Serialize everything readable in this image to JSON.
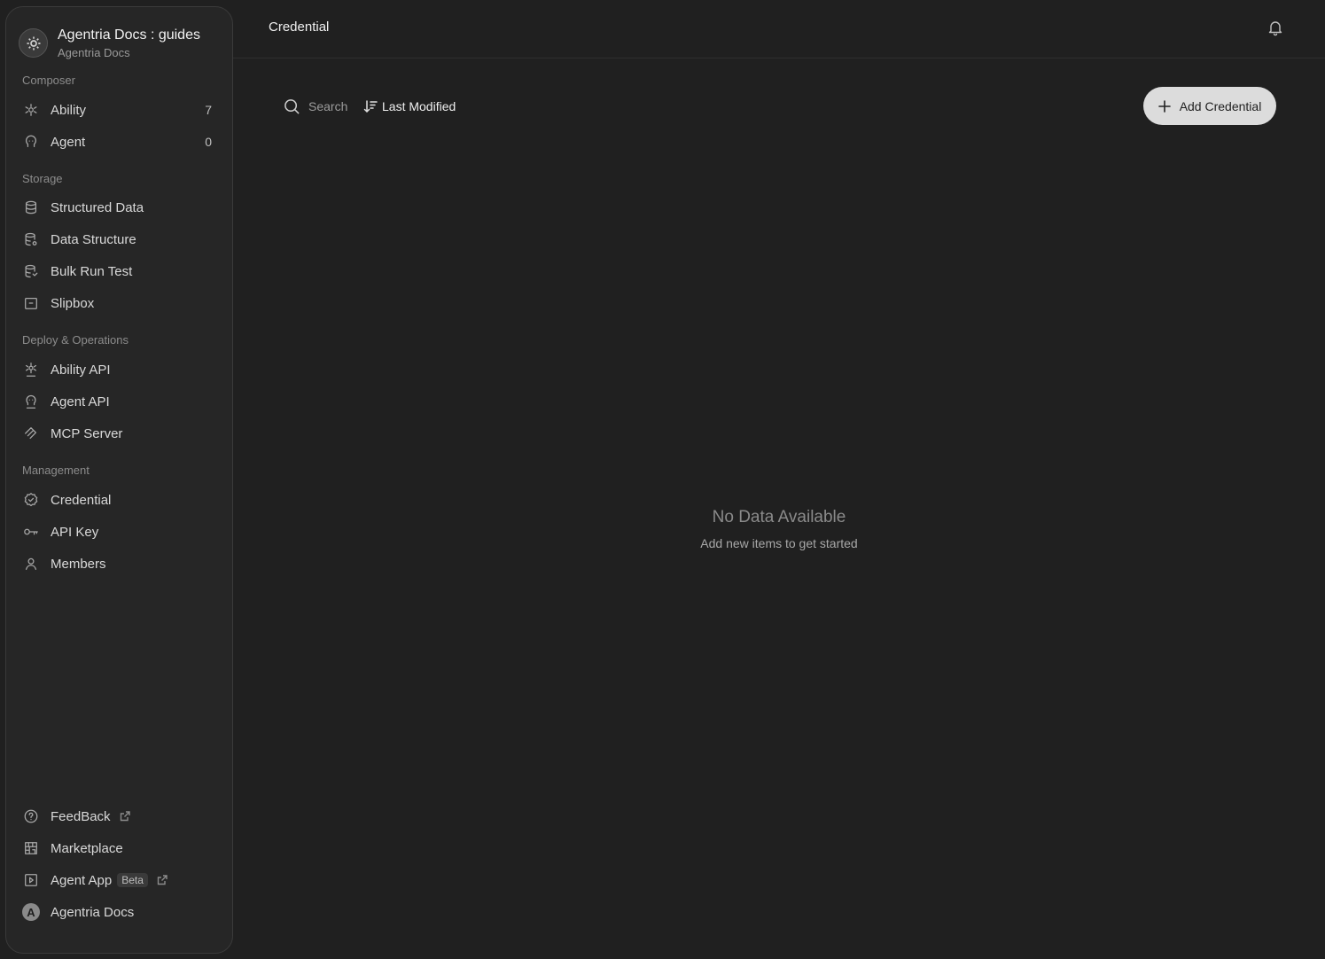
{
  "workspace": {
    "title": "Agentria Docs : guides",
    "subtitle": "Agentria Docs",
    "logo_icon": "gear-icon"
  },
  "sidebar": {
    "sections": [
      {
        "label": "Composer"
      },
      {
        "label": "Storage"
      },
      {
        "label": "Deploy & Operations"
      },
      {
        "label": "Management"
      }
    ],
    "composer": [
      {
        "label": "Ability",
        "count": "7",
        "icon": "ability-icon"
      },
      {
        "label": "Agent",
        "count": "0",
        "icon": "agent-icon"
      }
    ],
    "storage": [
      {
        "label": "Structured Data",
        "icon": "database-icon"
      },
      {
        "label": "Data Structure",
        "icon": "database-settings-icon"
      },
      {
        "label": "Bulk Run Test",
        "icon": "database-test-icon"
      },
      {
        "label": "Slipbox",
        "icon": "box-icon"
      }
    ],
    "deploy": [
      {
        "label": "Ability API",
        "icon": "ability-api-icon"
      },
      {
        "label": "Agent API",
        "icon": "agent-api-icon"
      },
      {
        "label": "MCP Server",
        "icon": "mcp-icon"
      }
    ],
    "management": [
      {
        "label": "Credential",
        "icon": "badge-check-icon"
      },
      {
        "label": "API Key",
        "icon": "key-icon"
      },
      {
        "label": "Members",
        "icon": "user-icon"
      }
    ],
    "footer": [
      {
        "label": "FeedBack",
        "icon": "help-circle-icon"
      },
      {
        "label": "Marketplace",
        "icon": "store-icon"
      },
      {
        "label": "Agent App",
        "badge": "Beta",
        "icon": "play-square-icon"
      },
      {
        "label": "Agentria Docs",
        "avatar_letter": "A"
      }
    ]
  },
  "header": {
    "title": "Credential",
    "bell_icon": "bell-icon"
  },
  "toolbar": {
    "search_placeholder": "Search",
    "sort_label": "Last Modified",
    "add_label": "Add Credential"
  },
  "empty_state": {
    "title": "No Data Available",
    "subtitle": "Add new items to get started"
  }
}
